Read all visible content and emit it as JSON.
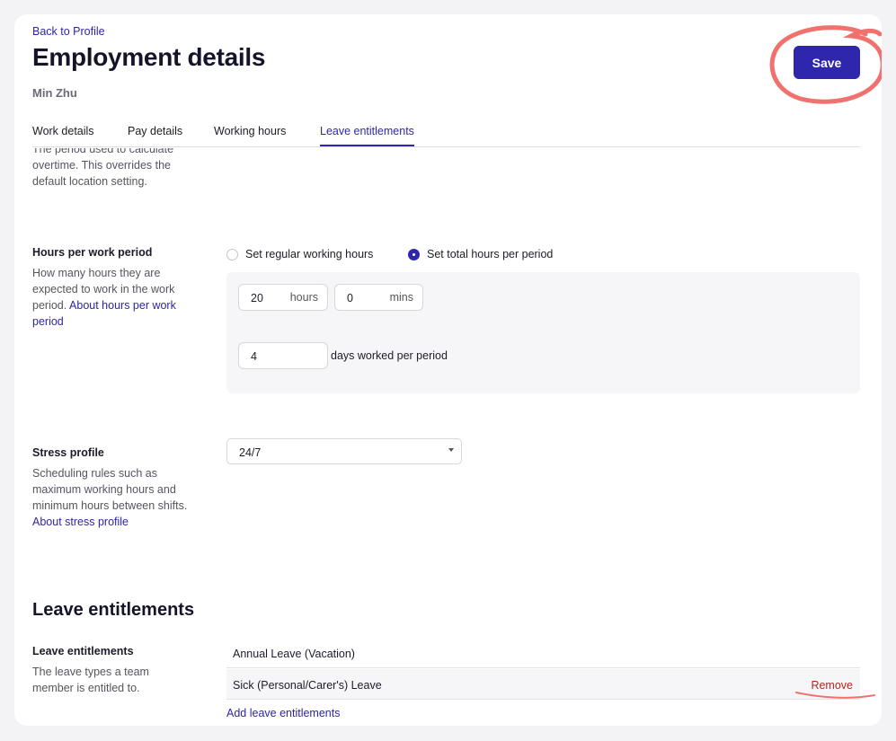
{
  "header": {
    "back_link": "Back to Profile",
    "title": "Employment details",
    "person_name": "Min Zhu",
    "save_label": "Save"
  },
  "tabs": [
    {
      "label": "Work details",
      "active": false
    },
    {
      "label": "Pay details",
      "active": false
    },
    {
      "label": "Working hours",
      "active": false
    },
    {
      "label": "Leave entitlements",
      "active": true
    }
  ],
  "overtime": {
    "description": "The period used to calculate overtime. This overrides the default location setting."
  },
  "hours_per_period": {
    "label": "Hours per work period",
    "description": "How many hours they are expected to work in the work period.",
    "link": "About hours per work period",
    "options": [
      {
        "label": "Set regular working hours",
        "selected": false
      },
      {
        "label": "Set total hours per period",
        "selected": true
      }
    ],
    "hours_value": "20",
    "hours_unit": "hours",
    "mins_value": "0",
    "mins_unit": "mins",
    "days_value": "4",
    "days_label": "days worked per period"
  },
  "stress_profile": {
    "label": "Stress profile",
    "description": "Scheduling rules such as maximum working hours and minimum hours between shifts.",
    "link": "About stress profile",
    "selected": "24/7"
  },
  "leave": {
    "section_title": "Leave entitlements",
    "label": "Leave entitlements",
    "description": "The leave types a team member is entitled to.",
    "items": [
      {
        "name": "Annual Leave (Vacation)"
      },
      {
        "name": "Sick (Personal/Carer's) Leave",
        "action": "Remove"
      }
    ],
    "add_link": "Add leave entitlements"
  },
  "colors": {
    "accent": "#2e27ad",
    "annotation": "#f0726e",
    "remove": "#b3261e"
  }
}
